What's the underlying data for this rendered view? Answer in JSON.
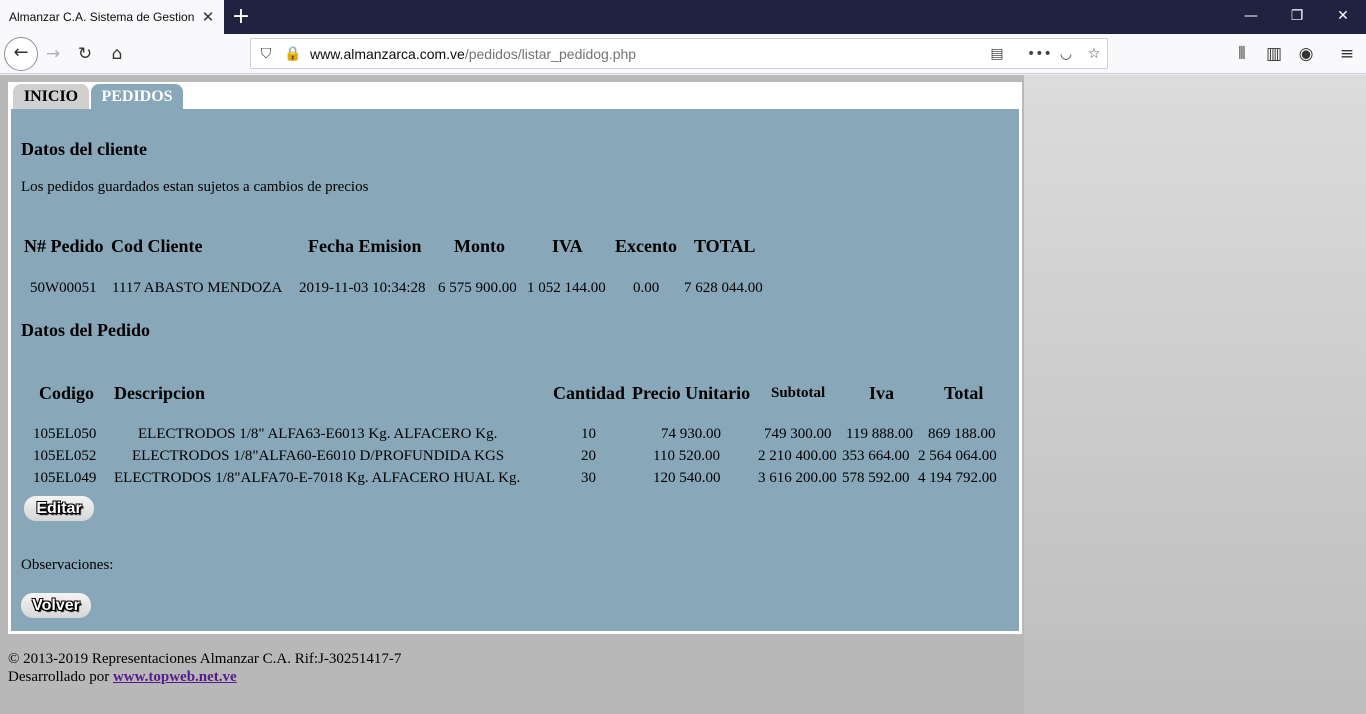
{
  "browser": {
    "tab_title": "Almanzar C.A. Sistema de Gestion d",
    "url_host": "www.almanzarca.com.ve",
    "url_path": "/pedidos/listar_pedidog.php"
  },
  "nav_tabs": [
    "INICIO",
    "PEDIDOS"
  ],
  "cliente": {
    "heading": "Datos del cliente",
    "notice": "Los pedidos guardados estan sujetos a cambios de precios",
    "headers": [
      "N# Pedido",
      "Cod Cliente",
      "Fecha Emision",
      "Monto",
      "IVA",
      "Excento",
      "TOTAL"
    ],
    "row": {
      "pedido": "50W00051",
      "cod_cliente": "1117 ABASTO MENDOZA",
      "fecha": "2019-11-03 10:34:28",
      "monto": "6 575 900.00",
      "iva": "1 052 144.00",
      "excento": "0.00",
      "total": "7 628 044.00"
    }
  },
  "pedido": {
    "heading": "Datos del Pedido",
    "headers": [
      "Codigo",
      "Descripcion",
      "Cantidad",
      "Precio Unitario",
      "Subtotal",
      "Iva",
      "Total"
    ],
    "rows": [
      {
        "codigo": "105EL050",
        "descripcion": "ELECTRODOS 1/8\" ALFA63-E6013 Kg. ALFACERO Kg.",
        "cantidad": "10",
        "precio": "74 930.00",
        "subtotal": "749 300.00",
        "iva": "119 888.00",
        "total": "869 188.00"
      },
      {
        "codigo": "105EL052",
        "descripcion": "ELECTRODOS 1/8\"ALFA60-E6010 D/PROFUNDIDA KGS",
        "cantidad": "20",
        "precio": "110 520.00",
        "subtotal": "2 210 400.00",
        "iva": "353 664.00",
        "total": "2 564 064.00"
      },
      {
        "codigo": "105EL049",
        "descripcion": "ELECTRODOS 1/8\"ALFA70-E-7018 Kg. ALFACERO HUAL Kg.",
        "cantidad": "30",
        "precio": "120 540.00",
        "subtotal": "3 616 200.00",
        "iva": "578 592.00",
        "total": "4 194 792.00"
      }
    ]
  },
  "buttons": {
    "editar": "Editar",
    "volver": "Volver"
  },
  "observaciones_label": "Observaciones:",
  "footer": {
    "copyright": "© 2013-2019 Representaciones Almanzar C.A. Rif:J-30251417-7",
    "dev_prefix": "Desarrollado por ",
    "dev_link": "www.topweb.net.ve"
  }
}
